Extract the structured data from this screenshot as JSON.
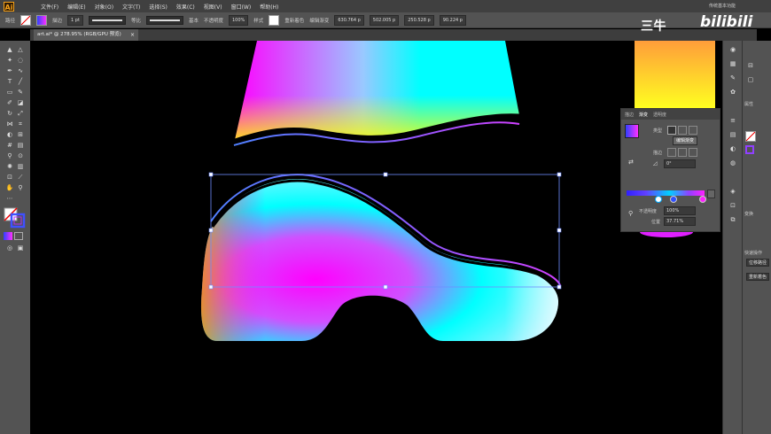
{
  "app": {
    "logo": "Ai",
    "workspace": "传统基本功能"
  },
  "menu": [
    "文件(F)",
    "编辑(E)",
    "对象(O)",
    "文字(T)",
    "选择(S)",
    "效果(C)",
    "视图(V)",
    "窗口(W)",
    "帮助(H)"
  ],
  "control_bar": {
    "label_path": "路径",
    "stroke_label": "描边",
    "stroke_value": "1 pt",
    "profile1": "等比",
    "profile2": "基本",
    "opacity_label": "不透明度",
    "opacity_value": "100%",
    "style_label": "样式",
    "recolor": "重新着色",
    "edit_gradient": "编辑渐变",
    "x_value": "630.764 p",
    "y_value": "502.005 p",
    "w_value": "250.528 p",
    "h_value": "90.224 p"
  },
  "document_tab": {
    "title": "art.ai* @ 278.95% (RGB/GPU 预览)",
    "close": "×"
  },
  "gradient_panel": {
    "tabs": [
      "描边",
      "渐变",
      "透明度"
    ],
    "type_label": "类型",
    "edit_button": "编辑渐变",
    "stroke_label": "描边",
    "angle_value": "0°",
    "opacity_label": "不透明度",
    "opacity_value": "100%",
    "position_label": "位置",
    "position_value": "37.71%"
  },
  "right_panel": {
    "label1": "属性",
    "label2": "变换",
    "label3": "快速操作",
    "btn1": "位移路径",
    "btn2": "重新着色"
  },
  "watermark": {
    "text": "三牛",
    "site": "bilibili"
  },
  "colors": {
    "panel_bg": "#535353",
    "canvas_bg": "#000000",
    "magenta": "#ff00ff",
    "cyan": "#00ffff",
    "yellow": "#ffff00",
    "selection": "#6e8cff"
  }
}
